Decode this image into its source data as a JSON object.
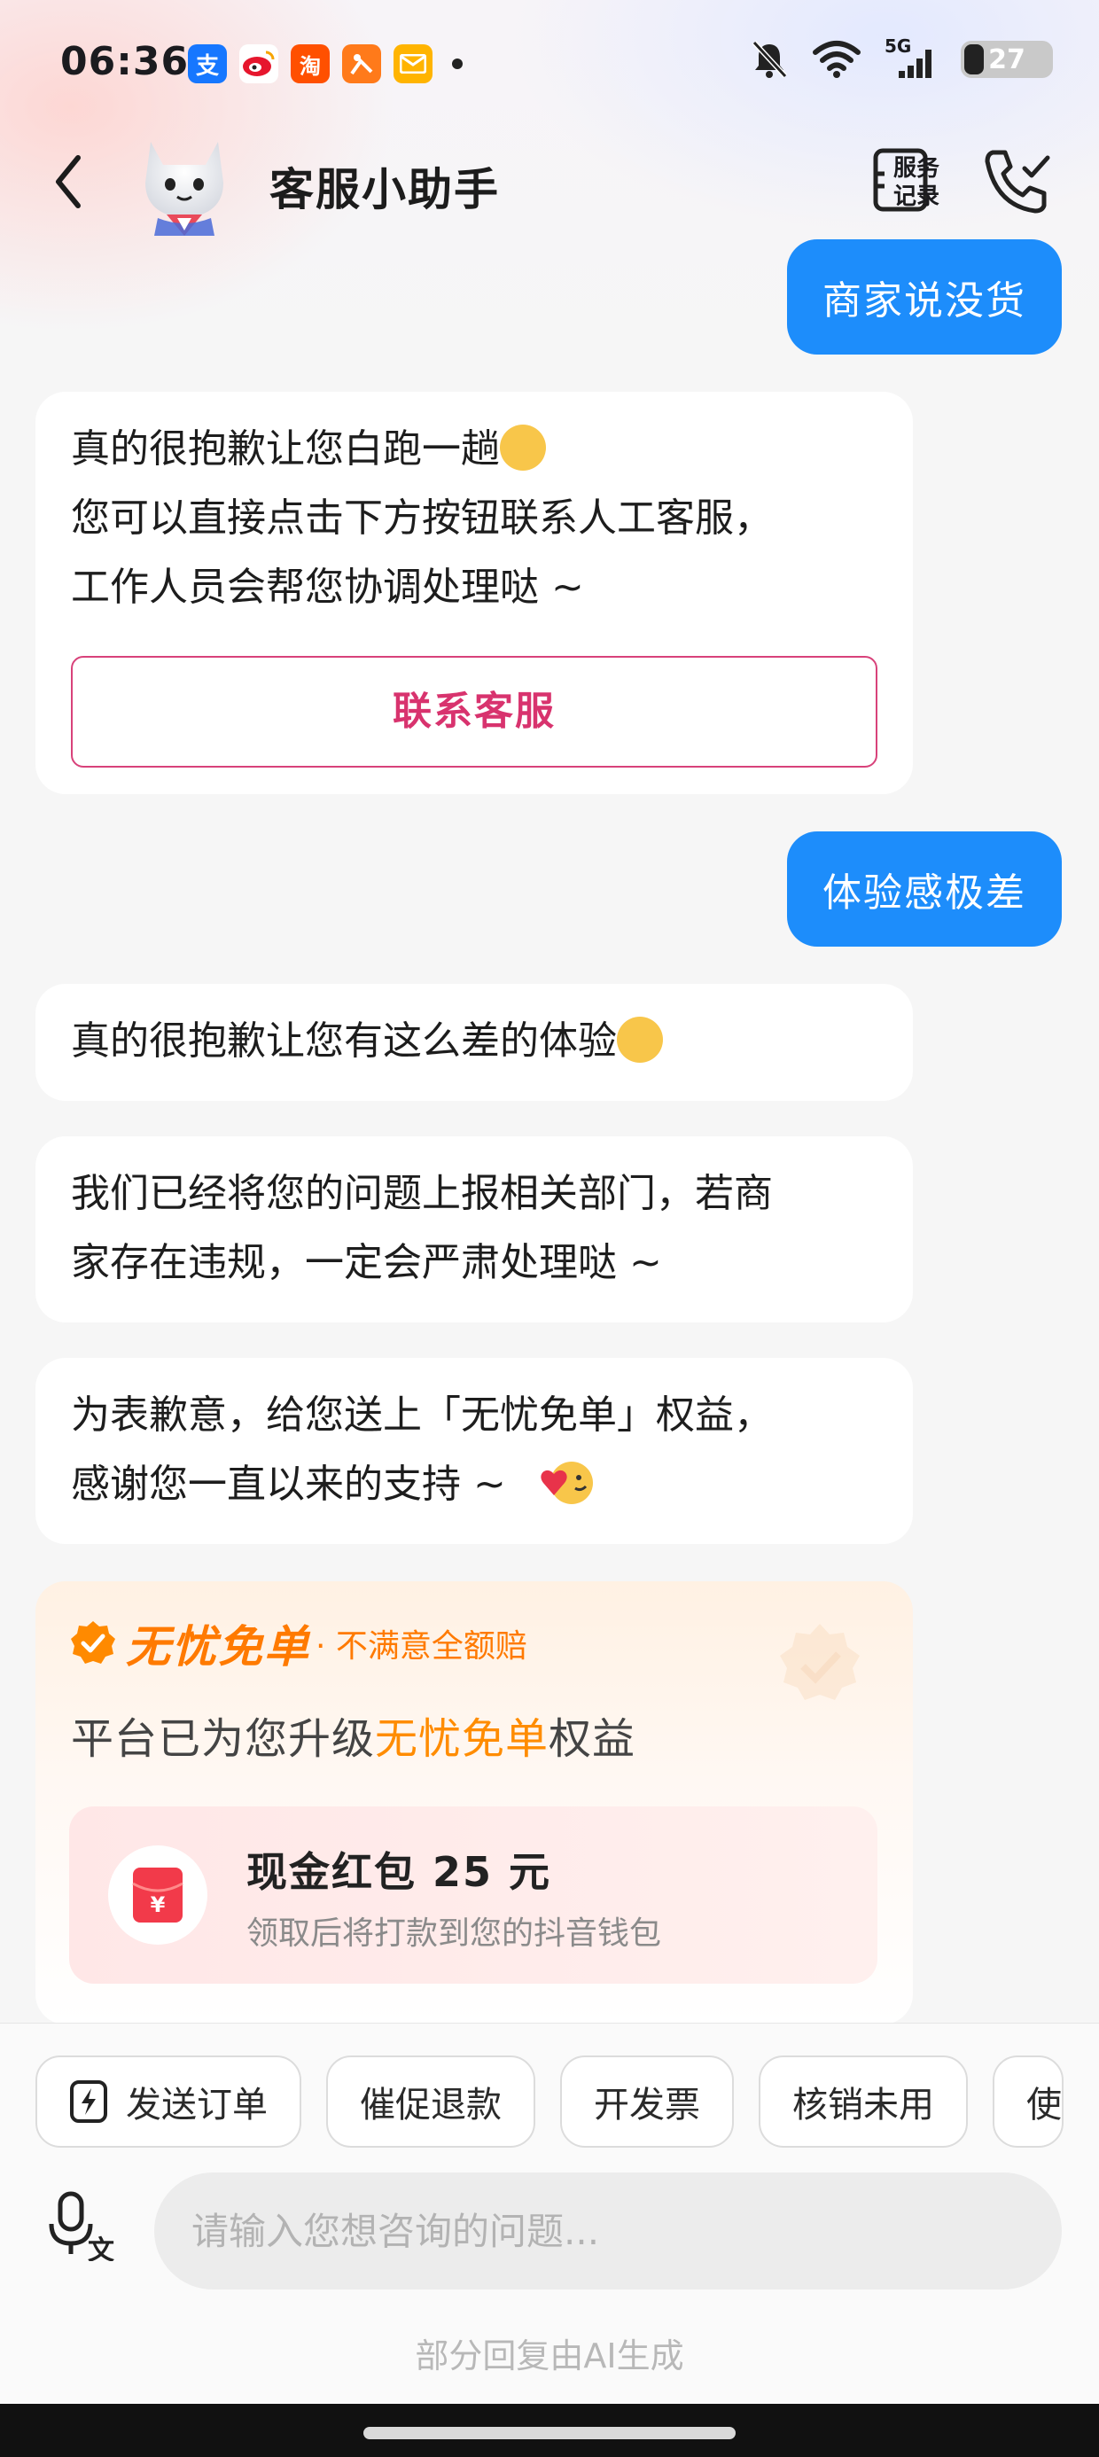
{
  "status_bar": {
    "time": "06:36",
    "app_icons": [
      "alipay-icon",
      "weibo-icon",
      "taobao-icon",
      "xianyu-icon",
      "mail-icon"
    ],
    "network": "5G",
    "battery": "27"
  },
  "header": {
    "title": "客服小助手",
    "service_records_label": "服务记录",
    "service_records_line1": "服务",
    "service_records_line2": "记录"
  },
  "messages": {
    "m1": "商家说没货",
    "m2_line1": "真的很抱歉让您白跑一趟",
    "m2_line2": "您可以直接点击下方按钮联系人工客服，",
    "m2_line3": "工作人员会帮您协调处理哒 ~",
    "m2_button": "联系客服",
    "m3": "体验感极差",
    "m4": "真的很抱歉让您有这么差的体验",
    "m5_line1": "我们已经将您的问题上报相关部门，若商",
    "m5_line2": "家存在违规，一定会严肃处理哒 ~",
    "m6_line1": "为表歉意，给您送上「无忧免单」权益，",
    "m6_line2": "感谢您一直以来的支持 ~"
  },
  "card": {
    "tag": "无忧免单",
    "subtitle": "· 不满意全额赔",
    "line_prefix": "平台已为您升级",
    "line_highlight": "无忧免单",
    "line_suffix": "权益",
    "redpacket_title": "现金红包 25 元",
    "redpacket_desc": "领取后将打款到您的抖音钱包",
    "redpacket_symbol": "¥"
  },
  "quick_actions": [
    "发送订单",
    "催促退款",
    "开发票",
    "核销未用",
    "使"
  ],
  "input": {
    "placeholder": "请输入您想咨询的问题..."
  },
  "ai_note": "部分回复由AI生成",
  "colors": {
    "user_bubble": "#1d8dfb",
    "accent_orange": "#ff7a00",
    "contact_pink": "#d8336e"
  }
}
